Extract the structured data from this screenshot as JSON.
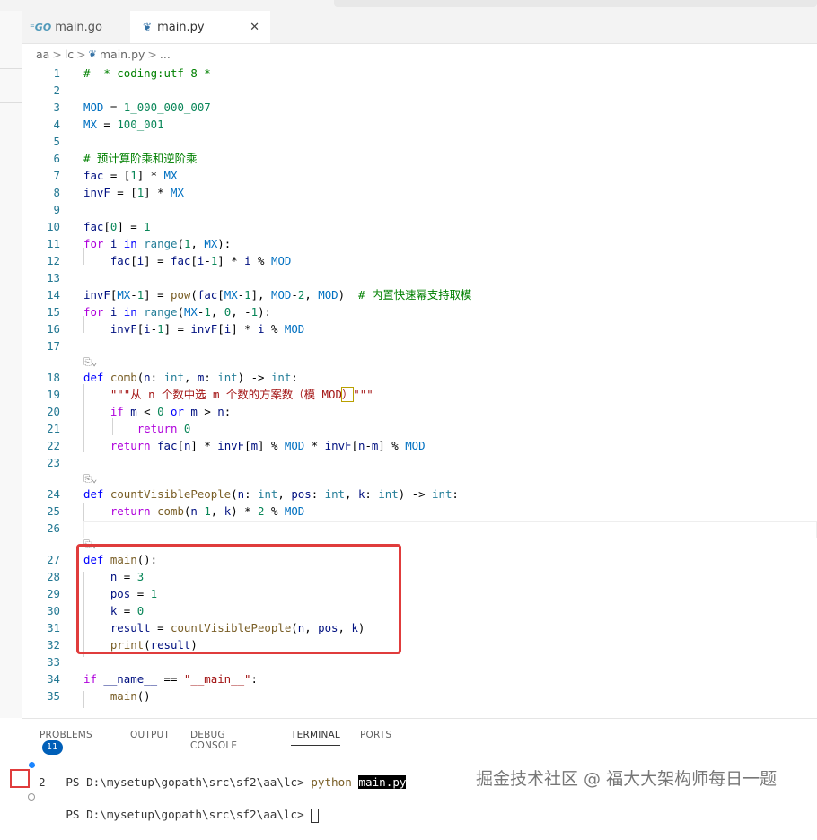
{
  "tabs": [
    {
      "label": "main.go",
      "icon": "go-file-icon",
      "active": false
    },
    {
      "label": "main.py",
      "icon": "python-file-icon",
      "active": true
    }
  ],
  "breadcrumb": [
    "aa",
    "lc",
    "main.py",
    "..."
  ],
  "lines": [
    "1",
    "2",
    "3",
    "4",
    "5",
    "6",
    "7",
    "8",
    "9",
    "10",
    "11",
    "12",
    "13",
    "14",
    "15",
    "16",
    "17",
    "18",
    "19",
    "20",
    "21",
    "22",
    "23",
    "24",
    "25",
    "26",
    "27",
    "28",
    "29",
    "30",
    "31",
    "32",
    "33",
    "34",
    "35"
  ],
  "panel": {
    "tabs": {
      "problems": "PROBLEMS",
      "problems_count": "11",
      "output": "OUTPUT",
      "debug": "DEBUG CONSOLE",
      "terminal": "TERMINAL",
      "ports": "PORTS"
    },
    "terminal": {
      "prompt": "PS D:\\mysetup\\gopath\\src\\sf2\\aa\\lc>",
      "command": "python",
      "file": "main.py",
      "output": "2"
    }
  },
  "watermark": "掘金技术社区 @ 福大大架构师每日一题",
  "colors": {
    "highlight": "#e03c3c",
    "keyword": "#0000ff",
    "number": "#098658",
    "comment": "#008000",
    "badge": "#005fb8"
  }
}
